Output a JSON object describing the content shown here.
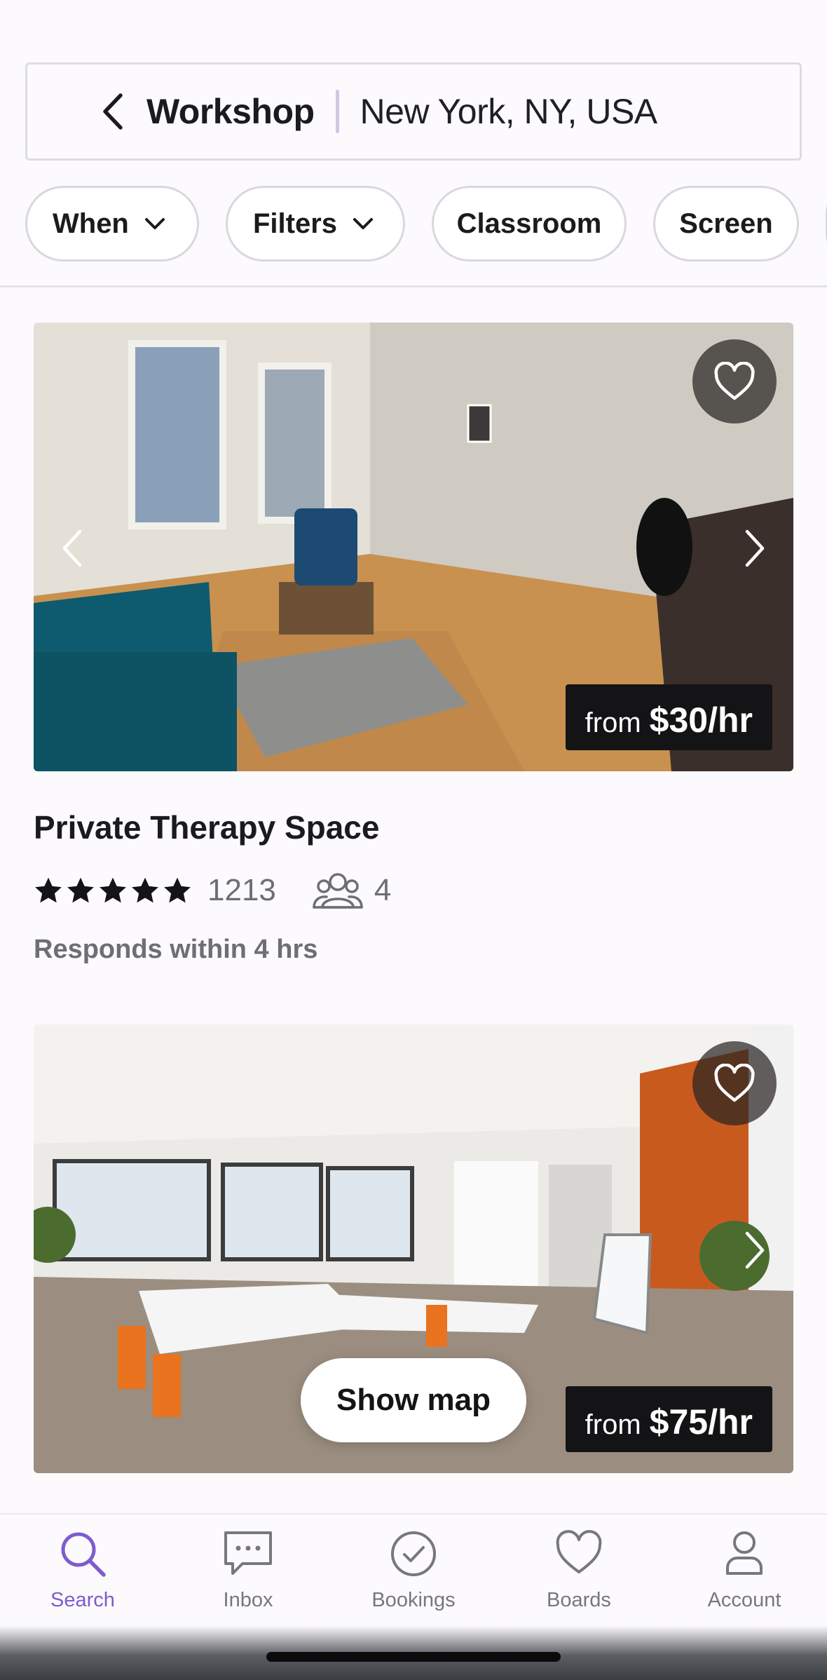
{
  "search": {
    "term": "Workshop",
    "location": "New York, NY, USA"
  },
  "chips": [
    {
      "label": "When",
      "dropdown": true
    },
    {
      "label": "Filters",
      "dropdown": true
    },
    {
      "label": "Classroom",
      "dropdown": false
    },
    {
      "label": "Screen",
      "dropdown": false
    }
  ],
  "listings": [
    {
      "title": "Private Therapy Space",
      "price_prefix": "from",
      "price": "$30/hr",
      "rating_stars": 5,
      "review_count": "1213",
      "capacity": "4",
      "response": "Responds within 4 hrs"
    },
    {
      "price_prefix": "from",
      "price": "$75/hr"
    }
  ],
  "show_map_label": "Show map",
  "bottom_nav": [
    {
      "label": "Search",
      "icon": "search-icon",
      "active": true
    },
    {
      "label": "Inbox",
      "icon": "chat-icon",
      "active": false
    },
    {
      "label": "Bookings",
      "icon": "check-circle-icon",
      "active": false
    },
    {
      "label": "Boards",
      "icon": "heart-icon",
      "active": false
    },
    {
      "label": "Account",
      "icon": "person-icon",
      "active": false
    }
  ],
  "colors": {
    "accent": "#7e5bd0",
    "text": "#1b1b1f",
    "muted": "#6e6e76",
    "price_tag_bg": "#141416"
  }
}
